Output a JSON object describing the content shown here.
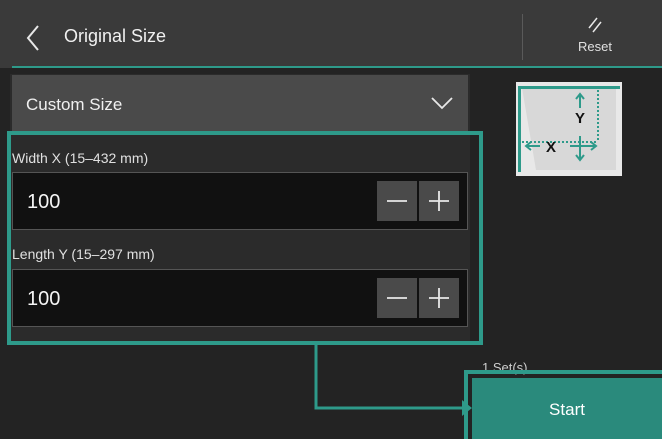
{
  "header": {
    "title": "Original Size",
    "back_icon": "chevron-left-icon",
    "reset_label": "Reset",
    "reset_icon": "reset-slashes-icon"
  },
  "size_dropdown": {
    "selected": "Custom Size",
    "icon": "chevron-down-icon"
  },
  "width_field": {
    "label": "Width X (15–432 mm)",
    "value": "100"
  },
  "length_field": {
    "label": "Length Y (15–297 mm)",
    "value": "100"
  },
  "preview": {
    "x_label": "X",
    "y_label": "Y"
  },
  "footer": {
    "sets": "1 Set(s)",
    "start_label": "Start"
  },
  "colors": {
    "accent": "#2e9a8a",
    "start": "#2a8a7c",
    "header": "#3a3a3a",
    "background": "#232323"
  }
}
